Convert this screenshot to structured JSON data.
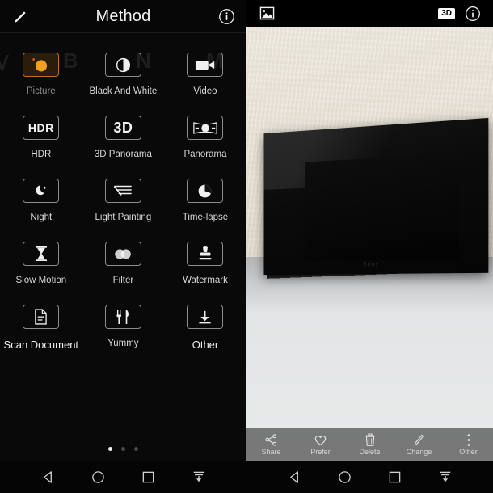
{
  "left_panel": {
    "header": {
      "title": "Method",
      "edit_icon": "pencil-icon",
      "info_icon": "info-icon"
    },
    "ghost_letters": [
      "V",
      "B",
      "N",
      "M"
    ],
    "modes": [
      {
        "label": "Picture",
        "icon": "camera-icon",
        "selected": true
      },
      {
        "label": "Black And White",
        "icon": "contrast-circle-icon",
        "selected": false
      },
      {
        "label": "Video",
        "icon": "video-camera-icon",
        "selected": false
      },
      {
        "label": "HDR",
        "icon": "hdr-text-icon",
        "selected": false
      },
      {
        "label": "3D Panorama",
        "icon": "3d-text-icon",
        "selected": false
      },
      {
        "label": "Panorama",
        "icon": "panorama-icon",
        "selected": false
      },
      {
        "label": "Night",
        "icon": "moon-star-icon",
        "selected": false
      },
      {
        "label": "Light Painting",
        "icon": "speed-lines-icon",
        "selected": false
      },
      {
        "label": "Time-lapse",
        "icon": "pie-clock-icon",
        "selected": false
      },
      {
        "label": "Slow Motion",
        "icon": "hourglass-icon",
        "selected": false
      },
      {
        "label": "Filter",
        "icon": "two-circles-icon",
        "selected": false
      },
      {
        "label": "Watermark",
        "icon": "stamp-icon",
        "selected": false
      },
      {
        "label": "Scan Document",
        "icon": "document-icon",
        "selected": false
      },
      {
        "label": "Yummy",
        "icon": "fork-knife-icon",
        "selected": false
      },
      {
        "label": "Other",
        "icon": "download-arrow-icon",
        "selected": false
      }
    ],
    "icon_text": {
      "hdr": "HDR",
      "three_d": "3D"
    },
    "page_dots": {
      "count": 3,
      "active_index": 0
    },
    "navbar": [
      {
        "name": "back-button",
        "icon": "triangle-left-icon"
      },
      {
        "name": "home-button",
        "icon": "circle-icon"
      },
      {
        "name": "recents-button",
        "icon": "square-icon"
      },
      {
        "name": "hide-navbar-button",
        "icon": "arrow-down-bar-icon"
      }
    ]
  },
  "right_panel": {
    "header": {
      "gallery_icon": "image-icon",
      "badge_3d": "3D",
      "info_icon": "info-icon"
    },
    "photo": {
      "description": "black digital photo frame standing on a light grey table against a cream textured wall",
      "frame_brand": "Sony"
    },
    "toolbar": [
      {
        "label": "Share",
        "icon": "share-nodes-icon"
      },
      {
        "label": "Prefer",
        "icon": "heart-icon"
      },
      {
        "label": "Delete",
        "icon": "trash-icon"
      },
      {
        "label": "Change",
        "icon": "pencil-edit-icon"
      },
      {
        "label": "Other",
        "icon": "kebab-menu-icon"
      }
    ],
    "navbar": [
      {
        "name": "back-button",
        "icon": "triangle-left-icon"
      },
      {
        "name": "home-button",
        "icon": "circle-icon"
      },
      {
        "name": "recents-button",
        "icon": "square-icon"
      },
      {
        "name": "hide-navbar-button",
        "icon": "arrow-down-bar-icon"
      }
    ]
  },
  "colors": {
    "accent": "#e8961e",
    "panel_bg": "#090909",
    "toolbar_bg": "#686868",
    "text": "#d8d8d8"
  }
}
